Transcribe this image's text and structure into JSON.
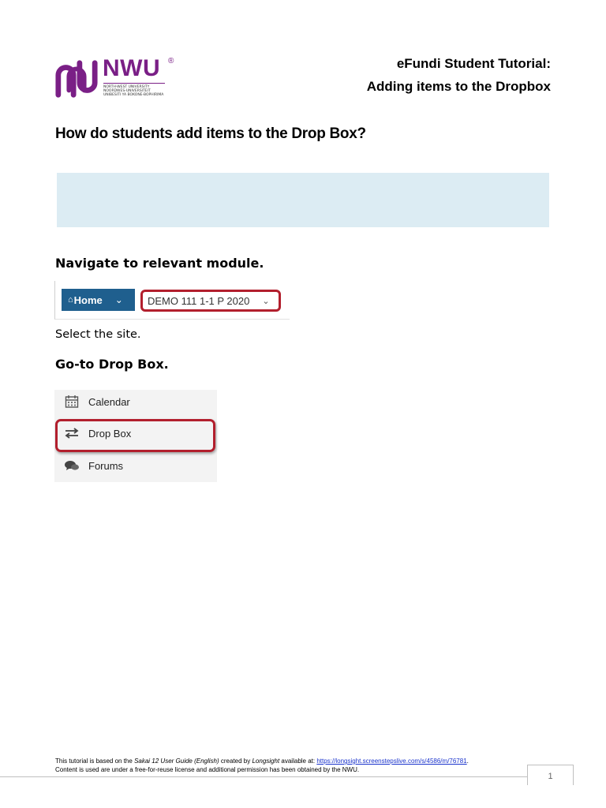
{
  "header": {
    "logo_text": "NWU",
    "logo_registered": "®",
    "logo_sub": [
      "NORTH-WEST UNIVERSITY",
      "NOORDWES-UNIVERSITEIT",
      "UNIBESITI YA BOKONE-BOPHIRIMA"
    ],
    "title_line1": "eFundi Student Tutorial:",
    "title_line2": "Adding items to the Dropbox"
  },
  "main_heading": "How do students add items to the Drop Box?",
  "steps": {
    "step1_heading": "Navigate to relevant module.",
    "home_label": "Home",
    "site_value": "DEMO 111 1-1 P 2020",
    "step1_text": "Select the site.",
    "step2_heading": "Go-to Drop Box."
  },
  "tool_menu": {
    "items": [
      {
        "label": "Calendar",
        "icon": "calendar-icon"
      },
      {
        "label": "Drop Box",
        "icon": "exchange-arrows-icon"
      },
      {
        "label": "Forums",
        "icon": "speech-bubbles-icon"
      }
    ]
  },
  "footer": {
    "line1_prefix": "This tutorial is based on the ",
    "line1_guide": "Sakai 12 User Guide (English)",
    "line1_mid": " created by ",
    "line1_author": "Longsight",
    "line1_suffix": " available at: ",
    "line1_link": "https://longsight.screenstepslive.com/s/4586/m/76781",
    "line1_end": ".",
    "line2": "Content is used are under a free-for-reuse license and additional permission has been obtained by the NWU.",
    "page_number": "1"
  },
  "colors": {
    "brand_purple": "#7a1f86",
    "highlight_red": "#b21f2d",
    "home_blue": "#1f5f8e",
    "info_box": "#dcecf3"
  }
}
